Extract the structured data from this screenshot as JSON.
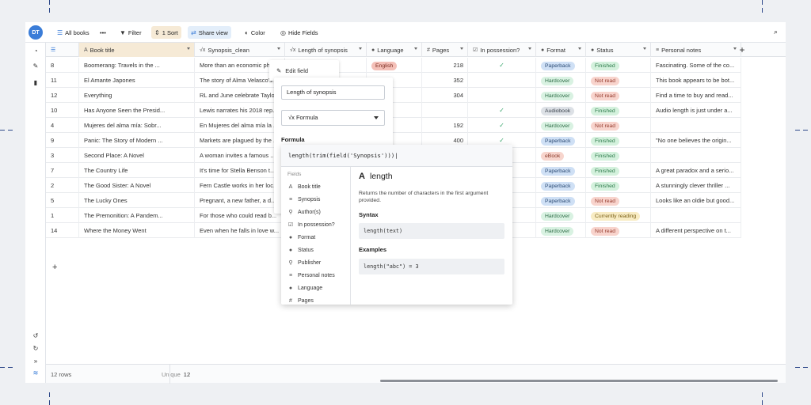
{
  "toolbar": {
    "avatar": "DT",
    "all_books": "All books",
    "more": "•••",
    "filter": "Filter",
    "sort": "1 Sort",
    "share_view": "Share view",
    "color": "Color",
    "hide_fields": "Hide Fields"
  },
  "columns": [
    {
      "label": "",
      "icon": "list-icon"
    },
    {
      "label": "Book title",
      "icon": "A"
    },
    {
      "label": "Synopsis_clean",
      "icon": "√x"
    },
    {
      "label": "Length of synopsis",
      "icon": "√x"
    },
    {
      "label": "Language",
      "icon": "●"
    },
    {
      "label": "Pages",
      "icon": "#"
    },
    {
      "label": "In possession?",
      "icon": "☑"
    },
    {
      "label": "Format",
      "icon": "●"
    },
    {
      "label": "Status",
      "icon": "●"
    },
    {
      "label": "Personal notes",
      "icon": "≡"
    }
  ],
  "rows": [
    {
      "id": "8",
      "title": "Boomerang: Travels in the ...",
      "synopsis": "More than an economic ph...",
      "language": "English",
      "pages": "218",
      "possession": true,
      "format": "Paperback",
      "status": "Finished",
      "notes": "Fascinating. Some of the co..."
    },
    {
      "id": "11",
      "title": "El Amante Japones",
      "synopsis": "The story of Alma Velasco's ...",
      "language": "",
      "pages": "352",
      "possession": false,
      "format": "Hardcover",
      "status": "Not read",
      "notes": "This book appears to be bot..."
    },
    {
      "id": "12",
      "title": "Everything",
      "synopsis": "RL and June celebrate Taylo...",
      "language": "",
      "pages": "304",
      "possession": false,
      "format": "Hardcover",
      "status": "Not read",
      "notes": "Find a time to buy and read..."
    },
    {
      "id": "10",
      "title": "Has Anyone Seen the Presid...",
      "synopsis": "Lewis narrates his 2018 rep...",
      "language": "",
      "pages": "",
      "possession": true,
      "format": "Audiobook",
      "status": "Finished",
      "notes": "Audio length is just under a..."
    },
    {
      "id": "4",
      "title": "Mujeres del alma mía: Sobr...",
      "synopsis": "En Mujeres del alma mía la ...",
      "language": "",
      "pages": "192",
      "possession": true,
      "format": "Hardcover",
      "status": "Not read",
      "notes": ""
    },
    {
      "id": "9",
      "title": "Panic: The Story of Modern ...",
      "synopsis": "Markets are plagued by the ...",
      "language": "",
      "pages": "400",
      "possession": true,
      "format": "Paperback",
      "status": "Finished",
      "notes": "\"No one believes the origin..."
    },
    {
      "id": "3",
      "title": "Second Place: A Novel",
      "synopsis": "A woman invites a famous ...",
      "language": "",
      "pages": "",
      "possession": false,
      "format": "eBook",
      "status": "Finished",
      "notes": ""
    },
    {
      "id": "7",
      "title": "The Country Life",
      "synopsis": "It's time for Stella Benson t...",
      "language": "",
      "pages": "",
      "possession": false,
      "format": "Paperback",
      "status": "Finished",
      "notes": "A great paradox and a serio..."
    },
    {
      "id": "2",
      "title": "The Good Sister: A Novel",
      "synopsis": "Fern Castle works in her loc...",
      "language": "",
      "pages": "",
      "possession": false,
      "format": "Paperback",
      "status": "Finished",
      "notes": "A stunningly clever thriller ..."
    },
    {
      "id": "5",
      "title": "The Lucky Ones",
      "synopsis": "Pregnant, a new father, a d...",
      "language": "",
      "pages": "",
      "possession": false,
      "format": "Paperback",
      "status": "Not read",
      "notes": "Looks like an oldie but good..."
    },
    {
      "id": "1",
      "title": "The Premonition: A Pandem...",
      "synopsis": "For those who could read b...",
      "language": "",
      "pages": "",
      "possession": false,
      "format": "Hardcover",
      "status": "Currently reading",
      "notes": ""
    },
    {
      "id": "14",
      "title": "Where the Money Went",
      "synopsis": "Even when he falls in love w...",
      "language": "",
      "pages": "",
      "possession": false,
      "format": "Hardcover",
      "status": "Not read",
      "notes": "A different perspective on t..."
    }
  ],
  "footer": {
    "rows": "12 rows",
    "unique_label": "Unique",
    "unique_value": "12"
  },
  "field_menu": {
    "edit_field": "Edit field"
  },
  "field_editor": {
    "name_value": "Length of synopsis",
    "type_value": "Formula",
    "formula_label": "Formula"
  },
  "formula": {
    "expression": "length(trim(field('Synopsis')))",
    "fields_heading": "Fields",
    "fields": [
      {
        "label": "Book title",
        "icon": "A"
      },
      {
        "label": "Synopsis",
        "icon": "≡"
      },
      {
        "label": "Author(s)",
        "icon": "⚲"
      },
      {
        "label": "In possession?",
        "icon": "☑"
      },
      {
        "label": "Format",
        "icon": "●"
      },
      {
        "label": "Status",
        "icon": "●"
      },
      {
        "label": "Publisher",
        "icon": "⚲"
      },
      {
        "label": "Personal notes",
        "icon": "≡"
      },
      {
        "label": "Language",
        "icon": "●"
      },
      {
        "label": "Pages",
        "icon": "#"
      }
    ],
    "doc_title": "length",
    "doc_desc": "Returns the number of characters in the first argument provided.",
    "syntax_heading": "Syntax",
    "syntax": "length(text)",
    "examples_heading": "Examples",
    "example": "length(\"abc\") = 3"
  },
  "colors": {
    "accent": "#3b7dd8",
    "sort_bg": "#f6ead6",
    "share_bg": "#e3eefa"
  }
}
